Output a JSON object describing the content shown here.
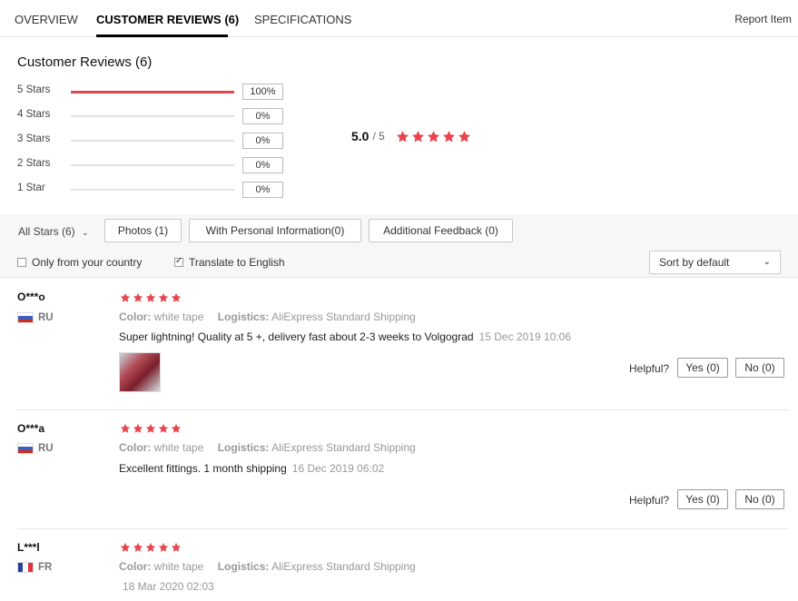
{
  "tabs": [
    {
      "label": "OVERVIEW"
    },
    {
      "label": "CUSTOMER REVIEWS (6)"
    },
    {
      "label": "SPECIFICATIONS"
    }
  ],
  "report_label": "Report Item",
  "summary": {
    "title": "Customer Reviews (6)",
    "rows": [
      {
        "label": "5 Stars",
        "pct": "100%",
        "fraction": 1.0
      },
      {
        "label": "4 Stars",
        "pct": "0%",
        "fraction": 0
      },
      {
        "label": "3 Stars",
        "pct": "0%",
        "fraction": 0
      },
      {
        "label": "2 Stars",
        "pct": "0%",
        "fraction": 0
      },
      {
        "label": "1 Star",
        "pct": "0%",
        "fraction": 0
      }
    ],
    "score": "5.0",
    "out_of": "/ 5",
    "star_count": 5
  },
  "filters": {
    "all_stars": "All Stars (6)",
    "photos": "Photos (1)",
    "personal": "With Personal Information(0)",
    "additional": "Additional Feedback (0)",
    "only_country": "Only from your country",
    "translate": "Translate to English",
    "translate_checked": true,
    "sort": "Sort by default"
  },
  "reviews": [
    {
      "user": "O***o",
      "country": "RU",
      "color_label": "Color:",
      "color_value": "white tape",
      "logistics_label": "Logistics:",
      "logistics_value": "AliExpress Standard Shipping",
      "text": "Super lightning! Quality at 5 +, delivery fast about 2-3 weeks to Volgograd",
      "date": "15 Dec 2019 10:06",
      "has_photo": true,
      "helpful_label": "Helpful?",
      "yes": "Yes (0)",
      "no": "No (0)"
    },
    {
      "user": "O***a",
      "country": "RU",
      "color_label": "Color:",
      "color_value": "white tape",
      "logistics_label": "Logistics:",
      "logistics_value": "AliExpress Standard Shipping",
      "text": "Excellent fittings. 1 month shipping",
      "date": "16 Dec 2019 06:02",
      "has_photo": false,
      "helpful_label": "Helpful?",
      "yes": "Yes (0)",
      "no": "No (0)"
    },
    {
      "user": "L***l",
      "country": "FR",
      "color_label": "Color:",
      "color_value": "white tape",
      "logistics_label": "Logistics:",
      "logistics_value": "AliExpress Standard Shipping",
      "text": "",
      "date": "18 Mar 2020 02:03"
    }
  ],
  "colors": {
    "star": "#e8444d",
    "bar_fill": "#e0454d"
  },
  "icons": {
    "star": "star-icon",
    "chevron": "chevron-down-icon"
  }
}
